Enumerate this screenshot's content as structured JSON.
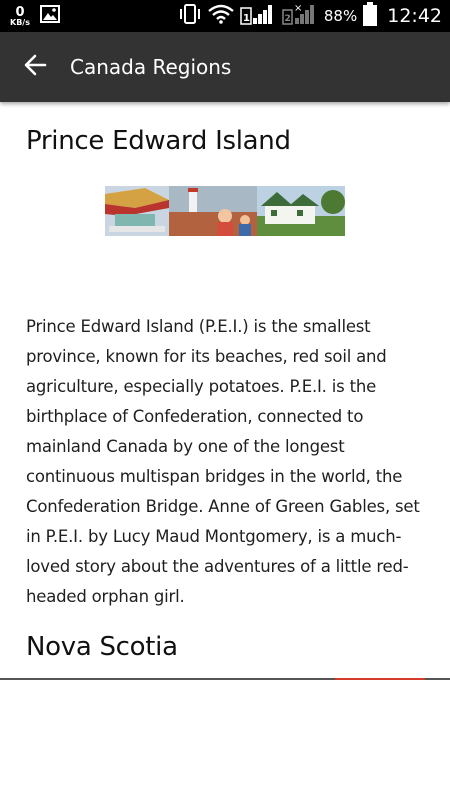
{
  "status_bar": {
    "network_speed_value": "0",
    "network_speed_unit": "KB/s",
    "battery_percent": "88%",
    "time": "12:42",
    "icons": [
      "image-icon",
      "vibrate-icon",
      "wifi-icon",
      "signal-sim1-icon",
      "signal-sim2-icon",
      "battery-icon"
    ]
  },
  "app_bar": {
    "back_icon": "arrow-left-icon",
    "title": "Canada Regions",
    "background": "#333333"
  },
  "sections": {
    "pei": {
      "heading": "Prince Edward Island",
      "banner_image": "pei-collage-image",
      "body": "Prince Edward Island (P.E.I.) is the smallest province, known for its beaches, red soil and agriculture, especially potatoes. P.E.I. is the birthplace of Confederation, connected to mainland Canada by one of the longest continuous multispan bridges in the world, the Confederation Bridge. Anne of Green Gables, set in P.E.I. by Lucy Maud Montgomery, is a much-loved story about the adventures of a little red-headed orphan girl."
    },
    "nova_scotia": {
      "heading": "Nova Scotia"
    }
  },
  "colors": {
    "accent": "#d63a2a",
    "text": "#1f1f1f"
  }
}
